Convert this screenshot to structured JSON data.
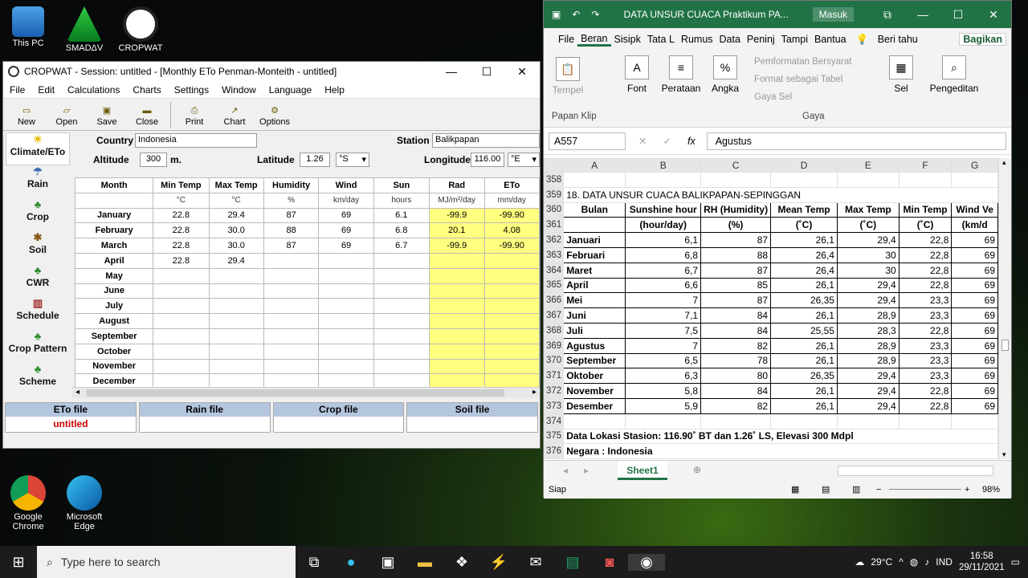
{
  "desktop": {
    "icons": [
      {
        "label": "This PC"
      },
      {
        "label": "SMADΔV"
      },
      {
        "label": "CROPWAT"
      },
      {
        "label": "Google Chrome"
      },
      {
        "label": "Microsoft Edge"
      }
    ]
  },
  "cropwat": {
    "title": "CROPWAT - Session: untitled - [Monthly ETo Penman-Monteith - untitled]",
    "menu": [
      "File",
      "Edit",
      "Calculations",
      "Charts",
      "Settings",
      "Window",
      "Language",
      "Help"
    ],
    "toolbar": [
      "New",
      "Open",
      "Save",
      "Close",
      "Print",
      "Chart",
      "Options"
    ],
    "sidebar": [
      "Climate/ETo",
      "Rain",
      "Crop",
      "Soil",
      "CWR",
      "Schedule",
      "Crop Pattern",
      "Scheme"
    ],
    "country_label": "Country",
    "country": "Indonesia",
    "station_label": "Station",
    "station": "Balikpapan",
    "altitude_label": "Altitude",
    "altitude": "300",
    "altitude_unit": "m.",
    "latitude_label": "Latitude",
    "latitude": "1.26",
    "latitude_dir": "°S",
    "longitude_label": "Longitude",
    "longitude": "116.00",
    "longitude_dir": "°E",
    "columns": [
      "Month",
      "Min Temp",
      "Max Temp",
      "Humidity",
      "Wind",
      "Sun",
      "Rad",
      "ETo"
    ],
    "units": [
      "",
      "°C",
      "°C",
      "%",
      "km/day",
      "hours",
      "MJ/m²/day",
      "mm/day"
    ],
    "rows": [
      [
        "January",
        "22.8",
        "29.4",
        "87",
        "69",
        "6.1",
        "-99.9",
        "-99.90"
      ],
      [
        "February",
        "22.8",
        "30.0",
        "88",
        "69",
        "6.8",
        "20.1",
        "4.08"
      ],
      [
        "March",
        "22.8",
        "30.0",
        "87",
        "69",
        "6.7",
        "-99.9",
        "-99.90"
      ],
      [
        "April",
        "22.8",
        "29.4",
        "",
        "",
        "",
        "",
        ""
      ],
      [
        "May",
        "",
        "",
        "",
        "",
        "",
        "",
        ""
      ],
      [
        "June",
        "",
        "",
        "",
        "",
        "",
        "",
        ""
      ],
      [
        "July",
        "",
        "",
        "",
        "",
        "",
        "",
        ""
      ],
      [
        "August",
        "",
        "",
        "",
        "",
        "",
        "",
        ""
      ],
      [
        "September",
        "",
        "",
        "",
        "",
        "",
        "",
        ""
      ],
      [
        "October",
        "",
        "",
        "",
        "",
        "",
        "",
        ""
      ],
      [
        "November",
        "",
        "",
        "",
        "",
        "",
        "",
        ""
      ],
      [
        "December",
        "",
        "",
        "",
        "",
        "",
        "",
        ""
      ]
    ],
    "files": [
      {
        "label": "ETo file",
        "value": "untitled"
      },
      {
        "label": "Rain file",
        "value": ""
      },
      {
        "label": "Crop file",
        "value": ""
      },
      {
        "label": "Soil file",
        "value": ""
      }
    ]
  },
  "excel": {
    "title": "DATA UNSUR CUACA Praktikum PA...",
    "signin": "Masuk",
    "tabs": [
      "File",
      "Beran",
      "Sisipk",
      "Tata L",
      "Rumus",
      "Data",
      "Peninj",
      "Tampi",
      "Bantua",
      "Beri tahu"
    ],
    "share": "Bagikan",
    "ribbon": {
      "paste": "Tempel",
      "clipboard": "Papan Klip",
      "font": "Font",
      "alignment": "Perataan",
      "number": "Angka",
      "cond_format": "Pemformatan Bersyarat",
      "format_table": "Format sebagai Tabel",
      "cell_styles": "Gaya Sel",
      "styles": "Gaya",
      "cells": "Sel",
      "editing": "Pengeditan"
    },
    "namebox": "A557",
    "formula": "Agustus",
    "col_headers": [
      "A",
      "B",
      "C",
      "D",
      "E",
      "F",
      "G"
    ],
    "rows": [
      {
        "n": "358",
        "cells": [
          "",
          "",
          "",
          "",
          "",
          "",
          ""
        ]
      },
      {
        "n": "359",
        "cells": [
          "18. DATA UNSUR CUACA BALIKPAPAN-SEPINGGAN",
          "",
          "",
          "",
          "",
          "",
          ""
        ]
      },
      {
        "n": "360",
        "cells": [
          "Bulan",
          "Sunshine hour",
          "RH (Humidity)",
          "Mean Temp",
          "Max Temp",
          "Min Temp",
          "Wind Ve"
        ]
      },
      {
        "n": "361",
        "cells": [
          "",
          "(hour/day)",
          "(%)",
          "(˚C)",
          "(˚C)",
          "(˚C)",
          "(km/d"
        ]
      },
      {
        "n": "362",
        "cells": [
          "Januari",
          "6,1",
          "87",
          "26,1",
          "29,4",
          "22,8",
          "69"
        ]
      },
      {
        "n": "363",
        "cells": [
          "Februari",
          "6,8",
          "88",
          "26,4",
          "30",
          "22,8",
          "69"
        ]
      },
      {
        "n": "364",
        "cells": [
          "Maret",
          "6,7",
          "87",
          "26,4",
          "30",
          "22,8",
          "69"
        ]
      },
      {
        "n": "365",
        "cells": [
          "April",
          "6,6",
          "85",
          "26,1",
          "29,4",
          "22,8",
          "69"
        ]
      },
      {
        "n": "366",
        "cells": [
          "Mei",
          "7",
          "87",
          "26,35",
          "29,4",
          "23,3",
          "69"
        ]
      },
      {
        "n": "367",
        "cells": [
          "Juni",
          "7,1",
          "84",
          "26,1",
          "28,9",
          "23,3",
          "69"
        ]
      },
      {
        "n": "368",
        "cells": [
          "Juli",
          "7,5",
          "84",
          "25,55",
          "28,3",
          "22,8",
          "69"
        ]
      },
      {
        "n": "369",
        "cells": [
          "Agustus",
          "7",
          "82",
          "26,1",
          "28,9",
          "23,3",
          "69"
        ]
      },
      {
        "n": "370",
        "cells": [
          "September",
          "6,5",
          "78",
          "26,1",
          "28,9",
          "23,3",
          "69"
        ]
      },
      {
        "n": "371",
        "cells": [
          "Oktober",
          "6,3",
          "80",
          "26,35",
          "29,4",
          "23,3",
          "69"
        ]
      },
      {
        "n": "372",
        "cells": [
          "November",
          "5,8",
          "84",
          "26,1",
          "29,4",
          "22,8",
          "69"
        ]
      },
      {
        "n": "373",
        "cells": [
          "Desember",
          "5,9",
          "82",
          "26,1",
          "29,4",
          "22,8",
          "69"
        ]
      },
      {
        "n": "374",
        "cells": [
          "",
          "",
          "",
          "",
          "",
          "",
          ""
        ]
      },
      {
        "n": "375",
        "cells": [
          "Data Lokasi Stasion:  116.90˚ BT dan 1.26˚ LS, Elevasi 300 Mdpl",
          "",
          "",
          "",
          "",
          "",
          ""
        ]
      },
      {
        "n": "376",
        "cells": [
          "Negara : Indonesia",
          "",
          "",
          "",
          "",
          "",
          ""
        ]
      }
    ],
    "sheet_tab": "Sheet1",
    "status": "Siap",
    "zoom": "98%"
  },
  "taskbar": {
    "search_placeholder": "Type here to search",
    "temp": "29°C",
    "lang": "IND",
    "time": "16:58",
    "date": "29/11/2021"
  },
  "colors": {
    "excel_green": "#217346",
    "cropwat_yellow": "#ffff80",
    "file_header": "#b4c6de"
  }
}
